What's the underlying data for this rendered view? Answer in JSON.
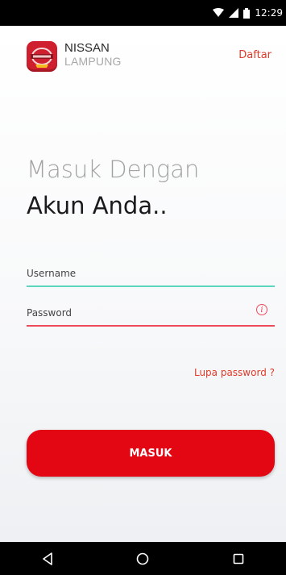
{
  "status_bar": {
    "time": "12:29"
  },
  "header": {
    "brand_name": "NISSAN",
    "brand_sub": "LAMPUNG",
    "register_label": "Daftar"
  },
  "title": {
    "line1": "Masuk Dengan",
    "line2": "Akun Anda.."
  },
  "form": {
    "username_placeholder": "Username",
    "password_placeholder": "Password",
    "forgot_label": "Lupa password ?",
    "submit_label": "MASUK"
  },
  "colors": {
    "accent": "#e30613",
    "link": "#e03a2a",
    "username_underline": "#5dd6c0",
    "password_underline": "#ef4a5b"
  },
  "icons": {
    "logo": "nissan-logo-icon",
    "password_hint": "info-icon",
    "nav_back": "back-triangle-icon",
    "nav_home": "home-circle-icon",
    "nav_recents": "recents-square-icon"
  }
}
